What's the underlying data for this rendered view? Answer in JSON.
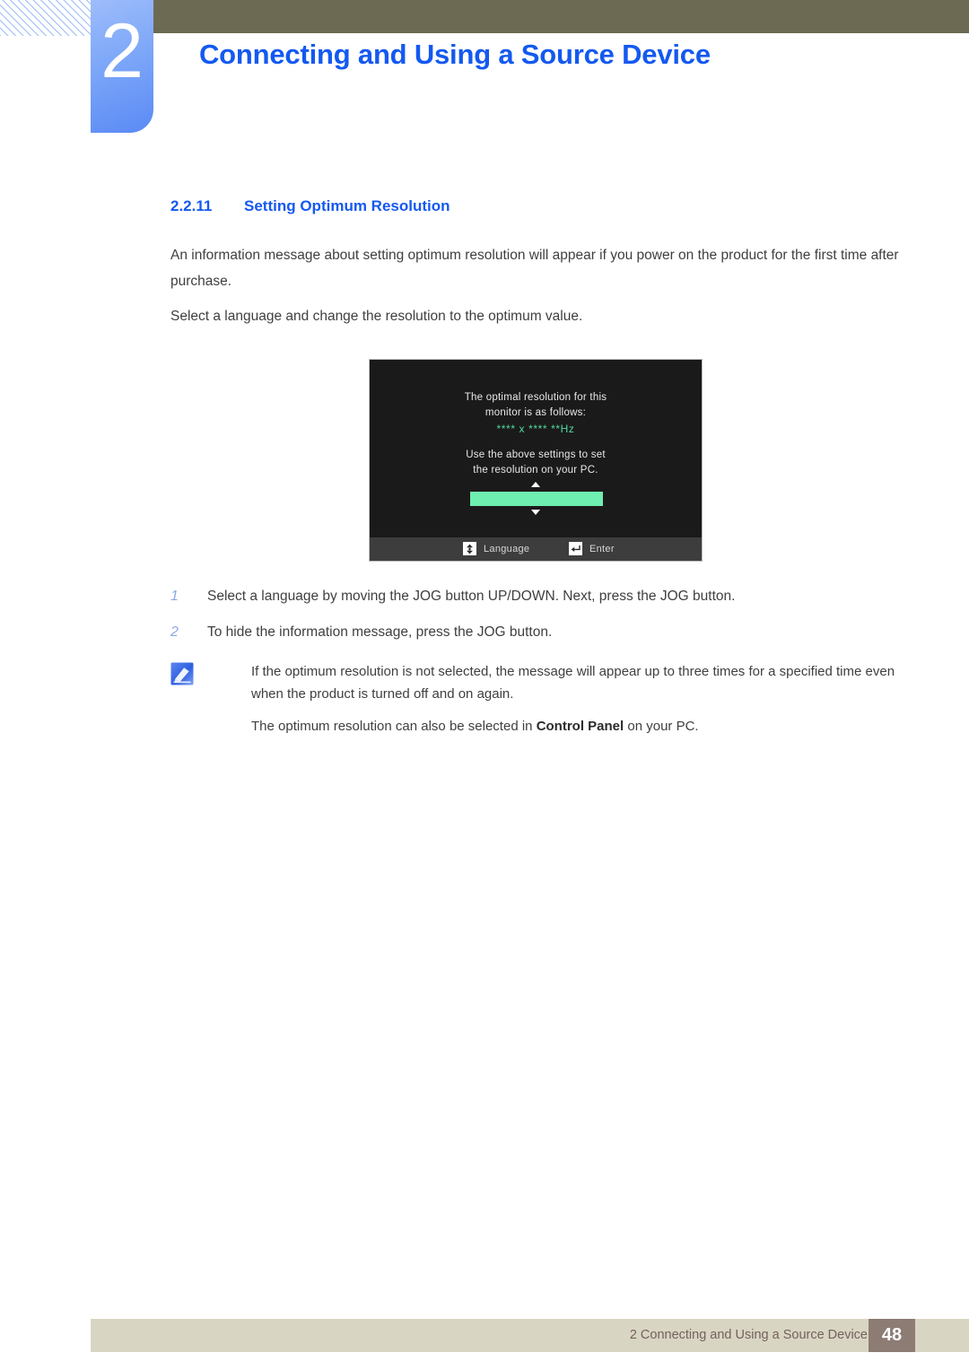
{
  "header": {
    "chapter_number": "2",
    "chapter_title": "Connecting and Using a Source Device",
    "tab_color": "#7da7f8",
    "bar_color": "#6d6a53",
    "title_color": "#1459f0"
  },
  "section": {
    "number": "2.2.11",
    "title": "Setting Optimum Resolution",
    "paragraphs": [
      "An information message about setting optimum resolution will appear if you power on the product for the first time after purchase.",
      "Select a language and change the resolution to the optimum value."
    ]
  },
  "osd": {
    "line1": "The optimal resolution for this",
    "line2": "monitor is as follows:",
    "resolution": "**** x ****  **Hz",
    "line3": "Use the above settings to set",
    "line4": "the resolution on your PC.",
    "resolution_color": "#4ddba0",
    "select_bar_color": "#6eeeb0",
    "background_color": "#1b1a1a",
    "footbar_color": "#3d3d3d",
    "keys": [
      {
        "icon": "updown-arrows-icon",
        "label": "Language"
      },
      {
        "icon": "enter-return-icon",
        "label": "Enter"
      }
    ]
  },
  "steps": [
    {
      "index": "1",
      "text": "Select a language by moving the JOG button UP/DOWN. Next, press the JOG button."
    },
    {
      "index": "2",
      "text": "To hide the information message, press the JOG button."
    }
  ],
  "note": {
    "icon": "note-pen-icon",
    "paragraph1": "If the optimum resolution is not selected, the message will appear up to three times for a specified time even when the product is turned off and on again.",
    "paragraph2_before": "The optimum resolution can also be selected in ",
    "paragraph2_bold": "Control Panel",
    "paragraph2_after": " on your PC."
  },
  "footer": {
    "text": "2 Connecting and Using a Source Device",
    "page_number": "48",
    "bar_color": "#d9d5c3",
    "page_box_color": "#8d7c74"
  }
}
